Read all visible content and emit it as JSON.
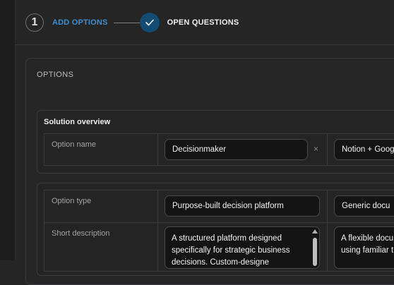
{
  "stepper": {
    "step1_number": "1",
    "step1_label": "ADD OPTIONS",
    "step2_label": "OPEN QUESTIONS"
  },
  "options": {
    "title": "OPTIONS",
    "solution_overview": {
      "title": "Solution overview",
      "option_name_label": "Option name",
      "option_names": [
        "Decisionmaker",
        "Notion + Goog"
      ],
      "remove_symbol": "×"
    },
    "details": {
      "option_type_label": "Option type",
      "option_types": [
        "Purpose-built decision platform",
        "Generic docu"
      ],
      "short_description_label": "Short description",
      "descriptions": [
        "A structured platform designed specifically for strategic business decisions. Custom-designe",
        "A flexible docu using familiar t"
      ]
    }
  },
  "colors": {
    "accent_blue": "#3d8fcf",
    "check_circle": "#134b73",
    "background": "#252526"
  }
}
